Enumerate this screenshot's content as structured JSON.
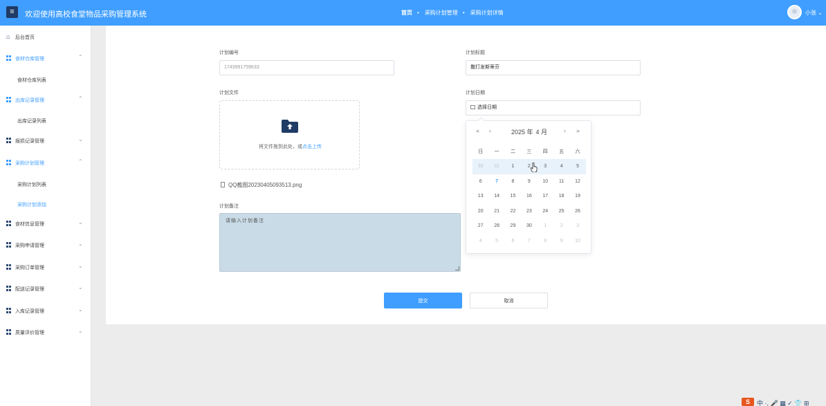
{
  "header": {
    "menu_glyph": "≡",
    "title": "欢迎使用高校食堂物品采购管理系统",
    "nav": [
      {
        "label": "首页",
        "active": true
      },
      {
        "label": "采购计划管理",
        "active": false
      },
      {
        "label": "采购计划详情",
        "active": false
      }
    ],
    "nav_separator": "•",
    "user": "小张",
    "user_caret": "⌄"
  },
  "sidebar": {
    "items": [
      {
        "label": "后台首页",
        "icon": "home-icon",
        "chevron": ""
      },
      {
        "label": "食材仓库管理",
        "icon": "grid-icon",
        "chevron": "⌃"
      },
      {
        "label": "食材仓库列表",
        "icon": "",
        "chevron": ""
      },
      {
        "label": "出库记录管理",
        "icon": "grid-icon",
        "chevron": "⌃"
      },
      {
        "label": "出库记录列表",
        "icon": "",
        "chevron": ""
      },
      {
        "label": "报损记录管理",
        "icon": "grid-icon",
        "chevron": "⌄"
      },
      {
        "label": "采购计划管理",
        "icon": "grid-icon",
        "chevron": "⌃"
      },
      {
        "label": "采购计划列表",
        "icon": "",
        "chevron": ""
      },
      {
        "label": "采购计划添加",
        "icon": "",
        "chevron": ""
      },
      {
        "label": "食材信息管理",
        "icon": "grid-icon",
        "chevron": "⌄"
      },
      {
        "label": "采购申请管理",
        "icon": "grid-icon",
        "chevron": "⌄"
      },
      {
        "label": "采购订单管理",
        "icon": "grid-icon",
        "chevron": "⌄"
      },
      {
        "label": "配送记录管理",
        "icon": "grid-icon",
        "chevron": "⌄"
      },
      {
        "label": "入库记录管理",
        "icon": "grid-icon",
        "chevron": "⌄"
      },
      {
        "label": "质量评价管理",
        "icon": "grid-icon",
        "chevron": "⌄"
      }
    ]
  },
  "form": {
    "plan_no_label": "计划编号",
    "plan_no_value": "1743991759633",
    "plan_title_label": "计划标题",
    "plan_title_value": "撒打发斯蒂芬",
    "plan_file_label": "计划文件",
    "upload_text": "将文件拖到此处，或",
    "upload_link": "点击上传",
    "uploaded_file": "QQ截图20230405093513.png",
    "plan_date_label": "计划日期",
    "plan_date_placeholder": "选择日期",
    "remark_label": "计划备注",
    "remark_placeholder": "请输入计划备注",
    "submit_label": "提交",
    "cancel_label": "取消"
  },
  "datepicker": {
    "prev_year": "«",
    "prev_month": "‹",
    "next_month": "›",
    "next_year": "»",
    "year": "2025 年",
    "month": "4 月",
    "weekdays": [
      "日",
      "一",
      "二",
      "三",
      "四",
      "五",
      "六"
    ],
    "days": [
      {
        "d": "30",
        "other": true
      },
      {
        "d": "31",
        "other": true
      },
      {
        "d": "1"
      },
      {
        "d": "2"
      },
      {
        "d": "3"
      },
      {
        "d": "4"
      },
      {
        "d": "5"
      },
      {
        "d": "6"
      },
      {
        "d": "7",
        "today": true
      },
      {
        "d": "8"
      },
      {
        "d": "9"
      },
      {
        "d": "10"
      },
      {
        "d": "11"
      },
      {
        "d": "12"
      },
      {
        "d": "13"
      },
      {
        "d": "14"
      },
      {
        "d": "15"
      },
      {
        "d": "16"
      },
      {
        "d": "17"
      },
      {
        "d": "18"
      },
      {
        "d": "19"
      },
      {
        "d": "20"
      },
      {
        "d": "21"
      },
      {
        "d": "22"
      },
      {
        "d": "23"
      },
      {
        "d": "24"
      },
      {
        "d": "25"
      },
      {
        "d": "26"
      },
      {
        "d": "27"
      },
      {
        "d": "28"
      },
      {
        "d": "29"
      },
      {
        "d": "30"
      },
      {
        "d": "1",
        "other": true
      },
      {
        "d": "2",
        "other": true
      },
      {
        "d": "3",
        "other": true
      },
      {
        "d": "4",
        "other": true
      },
      {
        "d": "5",
        "other": true
      },
      {
        "d": "6",
        "other": true
      },
      {
        "d": "7",
        "other": true
      },
      {
        "d": "8",
        "other": true
      },
      {
        "d": "9",
        "other": true
      },
      {
        "d": "10",
        "other": true
      }
    ]
  },
  "tray": {
    "logo": "S",
    "text": "中 ·, 🎤 ▦ ✓ 👕 ⊞"
  },
  "colors": {
    "primary": "#3f9eff",
    "header_bg": "#3f9eff",
    "menu_button": "#1f3b66",
    "textarea_bg": "#c9dbe6"
  }
}
